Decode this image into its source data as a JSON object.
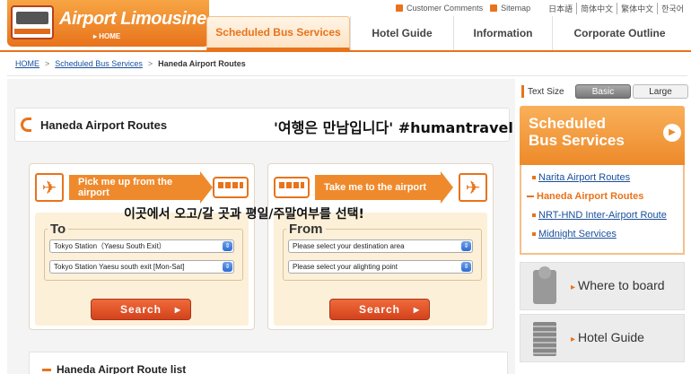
{
  "header": {
    "logo_text": "Airport Limousine",
    "logo_home": "HOME",
    "top_links": [
      {
        "label": "Customer Comments",
        "icon": "comment-icon"
      },
      {
        "label": "Sitemap",
        "icon": "sitemap-icon"
      }
    ],
    "languages": [
      "日本語",
      "简体中文",
      "繁体中文",
      "한국어"
    ],
    "nav": [
      {
        "label": "Scheduled Bus Services",
        "active": true
      },
      {
        "label": "Hotel Guide",
        "active": false
      },
      {
        "label": "Information",
        "active": false
      },
      {
        "label": "Corporate Outline",
        "active": false
      }
    ],
    "accent": "#e8731b"
  },
  "breadcrumb": [
    "HOME",
    "Scheduled Bus Services",
    "Haneda Airport Routes"
  ],
  "main": {
    "title": "Haneda Airport Routes",
    "overlay_caption_1": "'여행은 만남입니다' #humantravel",
    "overlay_caption_2": "이곳에서 오고/갈 곳과 평일/주말여부를 선택!",
    "panels": [
      {
        "banner": "Pick me up from the airport",
        "direction_label": "To",
        "select_1": "Tokyo Station（Yaesu South Exit）",
        "select_2": "Tokyo Station Yaesu south exit [Mon-Sat]",
        "button": "Search"
      },
      {
        "banner": "Take me to the airport",
        "direction_label": "From",
        "select_1": "Please select your destination area",
        "select_2": "Please select your alighting point",
        "button": "Search"
      }
    ],
    "list_title": "Haneda Airport Route list"
  },
  "sidebar": {
    "text_size_label": "Text Size",
    "text_size_basic": "Basic",
    "text_size_large": "Large",
    "section_title_1": "Scheduled",
    "section_title_2": "Bus Services",
    "items": [
      {
        "label": "Narita Airport Routes",
        "active": false
      },
      {
        "label": "Haneda Airport Routes",
        "active": true
      },
      {
        "label": "NRT-HND Inter-Airport Route",
        "active": false
      },
      {
        "label": "Midnight Services",
        "active": false
      }
    ],
    "blocks": [
      {
        "label": "Where to board",
        "icon": "bus-stop-icon"
      },
      {
        "label": "Hotel Guide",
        "icon": "hotel-icon"
      }
    ]
  }
}
